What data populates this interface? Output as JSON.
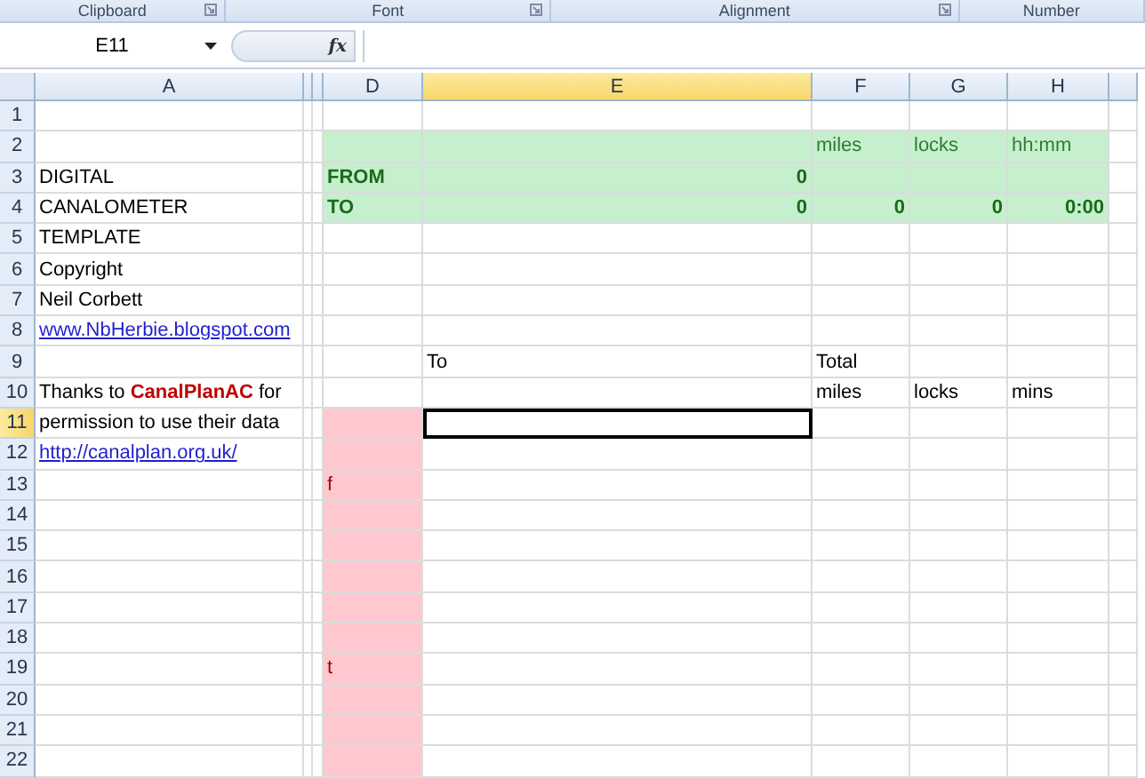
{
  "ribbon_groups": [
    {
      "label": "Clipboard",
      "launcher": true
    },
    {
      "label": "Font",
      "launcher": true
    },
    {
      "label": "Alignment",
      "launcher": true
    },
    {
      "label": "Number",
      "launcher": false
    }
  ],
  "name_box": "E11",
  "formula_button": "fx",
  "columns": [
    {
      "label": "A",
      "selected": false
    },
    {
      "label": "D",
      "selected": false
    },
    {
      "label": "E",
      "selected": true
    },
    {
      "label": "F",
      "selected": false
    },
    {
      "label": "G",
      "selected": false
    },
    {
      "label": "H",
      "selected": false
    }
  ],
  "rows": [
    {
      "number": "1",
      "selected": false
    },
    {
      "number": "2",
      "selected": false,
      "D": {
        "color": "#c6efce"
      },
      "E": {
        "color": "#c6efce"
      },
      "F": {
        "color": "#c6efce",
        "kind": "green",
        "text": "miles"
      },
      "G": {
        "color": "#c6efce",
        "kind": "green",
        "text": "locks"
      },
      "H": {
        "color": "#c6efce",
        "kind": "green",
        "text": "hh:mm"
      }
    },
    {
      "number": "3",
      "selected": false,
      "A": {
        "kind": "text",
        "text": "DIGITAL"
      },
      "D": {
        "color": "#c6efce",
        "kind": "green-bold",
        "text": "FROM"
      },
      "E": {
        "color": "#c6efce",
        "kind": "green-bold-number",
        "text": "0"
      },
      "F": {
        "color": "#c6efce"
      },
      "G": {
        "color": "#c6efce"
      },
      "H": {
        "color": "#c6efce"
      }
    },
    {
      "number": "4",
      "selected": false,
      "A": {
        "kind": "text",
        "text": "CANALOMETER"
      },
      "D": {
        "color": "#c6efce",
        "kind": "green-bold",
        "text": "TO"
      },
      "E": {
        "color": "#c6efce",
        "kind": "green-bold-number",
        "text": "0"
      },
      "F": {
        "color": "#c6efce",
        "kind": "green-bold-number",
        "text": "0"
      },
      "G": {
        "color": "#c6efce",
        "kind": "green-bold-number",
        "text": "0"
      },
      "H": {
        "color": "#c6efce",
        "kind": "green-bold-number",
        "text": "0:00"
      }
    },
    {
      "number": "5",
      "selected": false,
      "A": {
        "kind": "text",
        "text": "TEMPLATE"
      }
    },
    {
      "number": "6",
      "selected": false,
      "A": {
        "kind": "text",
        "text": "Copyright"
      }
    },
    {
      "number": "7",
      "selected": false,
      "A": {
        "kind": "text",
        "text": "Neil Corbett"
      }
    },
    {
      "number": "8",
      "selected": false,
      "A": {
        "kind": "link",
        "text": "www.NbHerbie.blogspot.com"
      }
    },
    {
      "number": "9",
      "selected": false,
      "E": {
        "kind": "text",
        "text": "To"
      },
      "F": {
        "kind": "text",
        "text": "Total"
      }
    },
    {
      "number": "10",
      "selected": false,
      "A": {
        "kind": "rich",
        "text": "Thanks to **CanalPlanAC** for"
      },
      "F": {
        "kind": "text",
        "text": "miles"
      },
      "G": {
        "kind": "text",
        "text": "locks"
      },
      "H": {
        "kind": "text",
        "text": "mins"
      }
    },
    {
      "number": "11",
      "selected": true,
      "A": {
        "kind": "text",
        "text": "permission to use their data"
      },
      "D": {
        "color": "#ffc7ce"
      },
      "E": {
        "active": true
      }
    },
    {
      "number": "12",
      "selected": false,
      "A": {
        "kind": "link",
        "text": "http://canalplan.org.uk/"
      },
      "D": {
        "color": "#ffc7ce"
      }
    },
    {
      "number": "13",
      "selected": false,
      "D": {
        "color": "#ffc7ce",
        "kind": "red",
        "text": "f"
      }
    },
    {
      "number": "14",
      "selected": false,
      "D": {
        "color": "#ffc7ce"
      }
    },
    {
      "number": "15",
      "selected": false,
      "D": {
        "color": "#ffc7ce"
      }
    },
    {
      "number": "16",
      "selected": false,
      "D": {
        "color": "#ffc7ce"
      }
    },
    {
      "number": "17",
      "selected": false,
      "D": {
        "color": "#ffc7ce"
      }
    },
    {
      "number": "18",
      "selected": false,
      "D": {
        "color": "#ffc7ce"
      }
    },
    {
      "number": "19",
      "selected": false,
      "D": {
        "color": "#ffc7ce",
        "kind": "red",
        "text": "t"
      }
    },
    {
      "number": "20",
      "selected": false,
      "D": {
        "color": "#ffc7ce"
      }
    },
    {
      "number": "21",
      "selected": false,
      "D": {
        "color": "#ffc7ce"
      }
    },
    {
      "number": "22",
      "selected": false,
      "D": {
        "color": "#ffc7ce"
      }
    }
  ]
}
